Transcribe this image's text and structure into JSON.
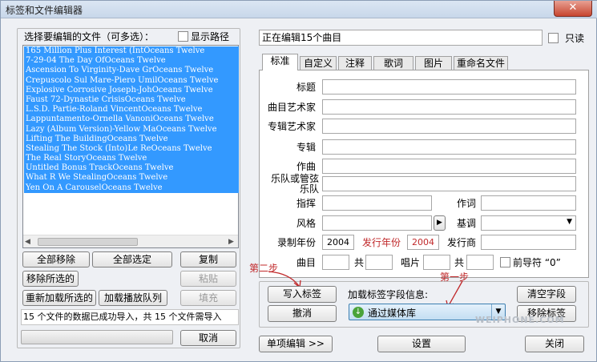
{
  "window": {
    "title": "标签和文件编辑器",
    "close_glyph": "✕"
  },
  "left": {
    "select_label": "选择要编辑的文件（可多选）：",
    "show_path": "显示路径",
    "files": [
      "165 Million Plus Interest (IntOceans Twelve",
      "7-29-04 The Day OfOceans Twelve",
      "Ascension To Virginity-Dave GrOceans Twelve",
      "Crepuscolo Sul Mare-Piero UmilOceans Twelve",
      "Explosive Corrosive Joseph-JohOceans Twelve",
      "Faust 72-Dynastie CrisisOceans Twelve",
      "L.S.D. Partie-Roland VincentOceans Twelve",
      "Lappuntamento-Ornella VanoniOceans Twelve",
      "Lazy (Album Version)-Yellow MaOceans Twelve",
      "Lifting The BuildingOceans Twelve",
      "Stealing The Stock (Into)Le ReOceans Twelve",
      "The Real StoryOceans Twelve",
      "Untitled Bonus TrackOceans Twelve",
      "What R We StealingOceans Twelve",
      "Yen On A CarouselOceans Twelve"
    ],
    "buttons": {
      "remove_all": "全部移除",
      "select_all": "全部选定",
      "copy": "复制",
      "remove_selected": "移除所选的",
      "paste": "粘贴",
      "reload_selected": "重新加载所选的",
      "load_playlist": "加载播放队列",
      "fill": "填充"
    },
    "status": "15 个文件的数据已成功导入，共 15 个文件需导入",
    "cancel": "取消"
  },
  "right": {
    "editing": "正在编辑15个曲目",
    "readonly": "只读",
    "tabs": [
      "标准",
      "自定义",
      "注释",
      "歌词",
      "图片",
      "重命名文件"
    ],
    "fields": {
      "title": "标题",
      "track_artist": "曲目艺术家",
      "album_artist": "专辑艺术家",
      "album": "专辑",
      "composer": "作曲",
      "band": "乐队或管弦乐队",
      "conductor": "指挥",
      "lyricist": "作词",
      "genre": "风格",
      "key": "基调",
      "rec_year": "录制年份",
      "rec_year_value": "2004",
      "release_year": "发行年份",
      "release_year_value": "2004",
      "publisher": "发行商",
      "track": "曲目",
      "of": "共",
      "disc": "唱片",
      "of2": "共",
      "leading_zero": "前导符 “0”"
    },
    "write_tags": "写入标签",
    "undo": "撤消",
    "load_info_label": "加载标签字段信息:",
    "source_option": "通过媒体库",
    "clear_fields": "清空字段",
    "remove_tags": "移除标签",
    "single_edit": "单项编辑 >>",
    "settings": "设置",
    "close": "关闭",
    "step1": "第一步",
    "step2": "第二步",
    "watermark": "WEIPHONE.COM"
  },
  "colors": {
    "selection": "#3399ff",
    "annotation": "#c0282a",
    "combo_accent": "#4aa33a"
  }
}
